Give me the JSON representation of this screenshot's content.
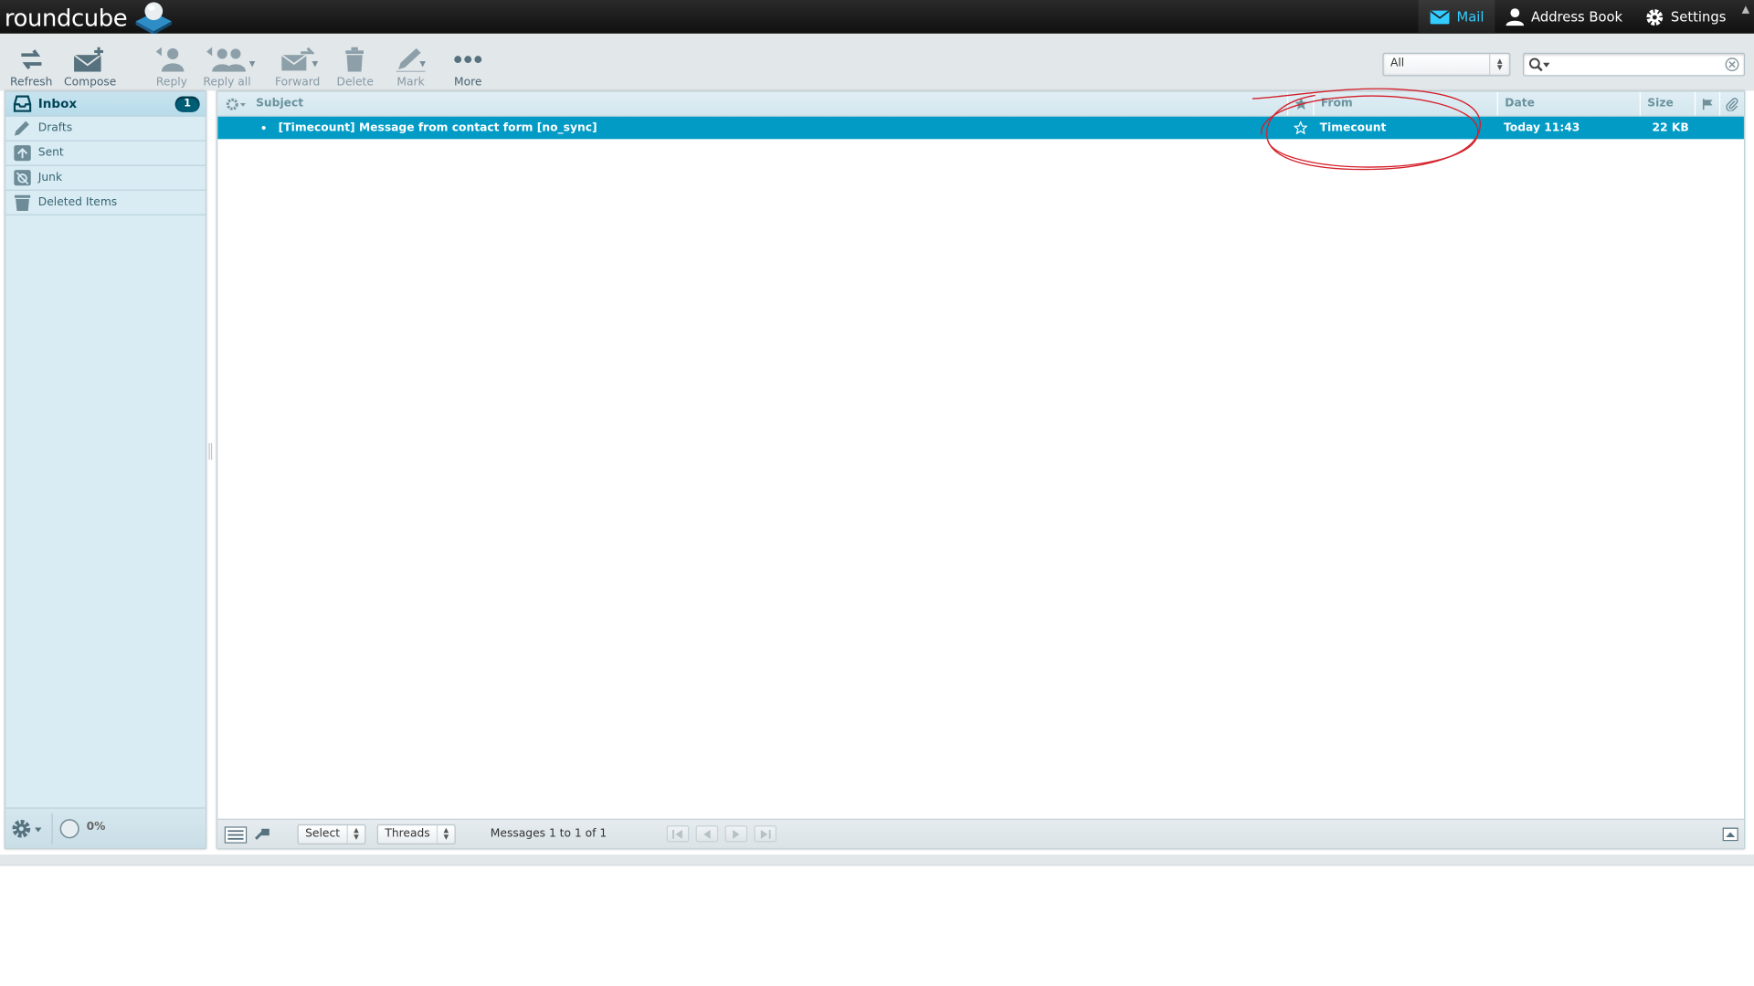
{
  "app": {
    "logo_text": "roundcube"
  },
  "taskmenu": {
    "mail": "Mail",
    "addressbook": "Address Book",
    "settings": "Settings"
  },
  "toolbar": {
    "refresh": "Refresh",
    "compose": "Compose",
    "reply": "Reply",
    "reply_all": "Reply all",
    "forward": "Forward",
    "delete": "Delete",
    "mark": "Mark",
    "more": "More"
  },
  "filter": {
    "selected": "All"
  },
  "search": {
    "value": "",
    "placeholder": ""
  },
  "folders": {
    "items": [
      {
        "label": "Inbox",
        "unread": "1"
      },
      {
        "label": "Drafts"
      },
      {
        "label": "Sent"
      },
      {
        "label": "Junk"
      },
      {
        "label": "Deleted Items"
      }
    ]
  },
  "quota": {
    "text": "0%"
  },
  "messagelist": {
    "columns": {
      "subject": "Subject",
      "from": "From",
      "date": "Date",
      "size": "Size"
    },
    "rows": [
      {
        "subject": "[Timecount] Message from contact form [no_sync]",
        "from": "Timecount",
        "date": "Today 11:43",
        "size": "22 KB"
      }
    ]
  },
  "listfooter": {
    "select": "Select",
    "threads": "Threads",
    "count": "Messages 1 to 1 of 1"
  },
  "colors": {
    "accent": "#019bc6",
    "topbar": "#1a1a1a",
    "sidebar": "#d9ecf4",
    "annotation": "#d4202a"
  }
}
